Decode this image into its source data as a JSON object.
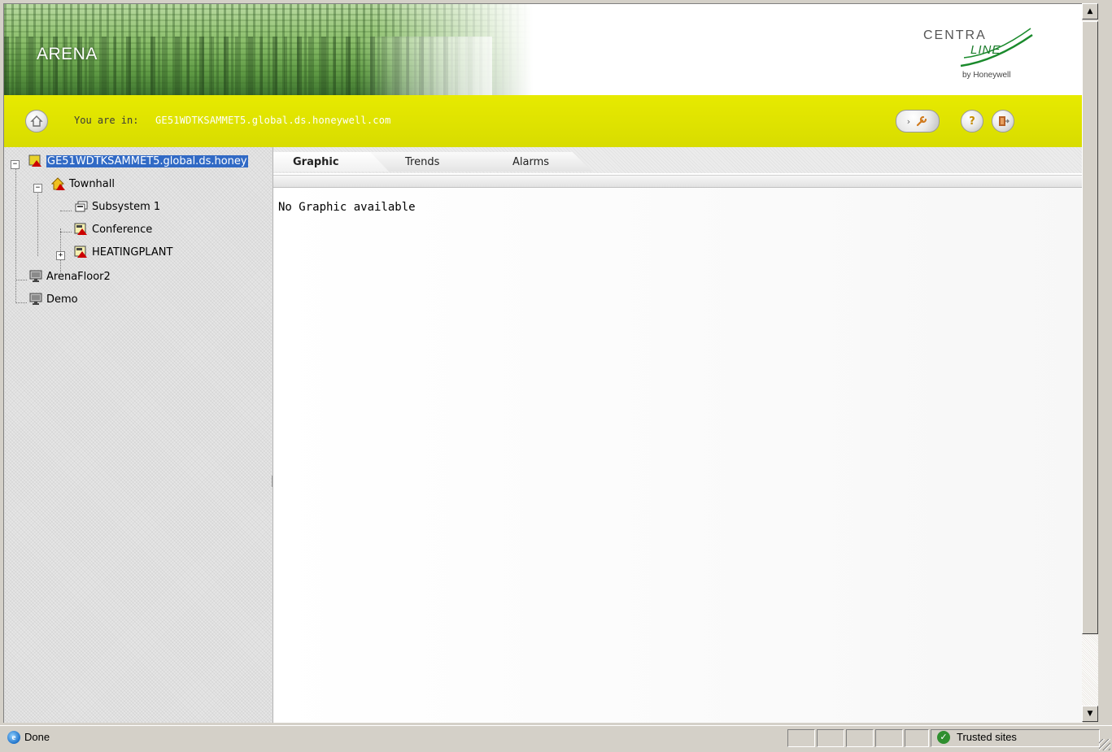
{
  "banner": {
    "title": "ARENA"
  },
  "logo": {
    "line1": "CENTRA",
    "line2": "LINE",
    "by": "by Honeywell"
  },
  "location": {
    "label": "You are in:",
    "value": "GE51WDTKSAMMET5.global.ds.honeywell.com"
  },
  "toolbar": {
    "tools_label": "›"
  },
  "tree": {
    "root": {
      "label": "GE51WDTKSAMMET5.global.ds.honey",
      "expander": "−"
    },
    "townhall": {
      "label": "Townhall",
      "expander": "−"
    },
    "subsystem": {
      "label": "Subsystem 1"
    },
    "conference": {
      "label": "Conference"
    },
    "heating": {
      "label": "HEATINGPLANT",
      "expander": "+"
    },
    "arenafloor": {
      "label": "ArenaFloor2"
    },
    "demo": {
      "label": "Demo"
    }
  },
  "tabs": [
    {
      "label": "Graphic",
      "active": true
    },
    {
      "label": "Trends",
      "active": false
    },
    {
      "label": "Alarms",
      "active": false
    }
  ],
  "content": {
    "message": "No Graphic available"
  },
  "status": {
    "text": "Done",
    "zone": "Trusted sites"
  },
  "colors": {
    "accent_yellow": "#dfe200",
    "selection": "#316ac5",
    "alarm_red": "#cc0000"
  },
  "icons": {
    "home": "home-icon",
    "tools": "wrench-icon",
    "help": "help-icon",
    "logout": "exit-door-icon",
    "site": "controller-alarm-icon",
    "building": "house-alarm-icon",
    "monitor": "monitor-icon",
    "check": "checkmark-icon"
  }
}
